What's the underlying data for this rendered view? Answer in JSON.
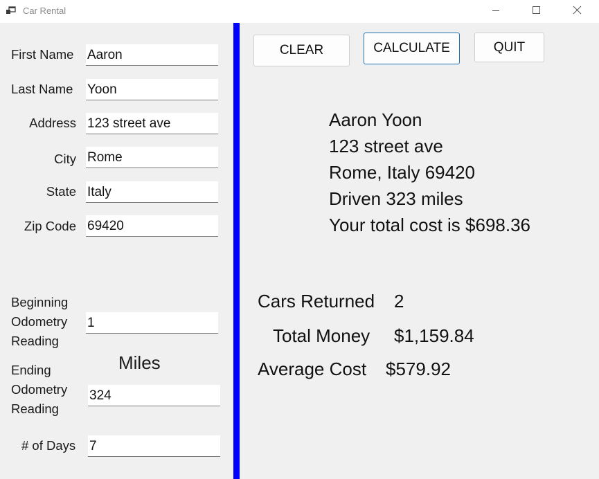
{
  "window": {
    "title": "Car Rental",
    "controls": {
      "minimize": "minimize-icon",
      "maximize": "maximize-icon",
      "close": "close-icon"
    }
  },
  "form": {
    "first_name_label": "First Name",
    "first_name": "Aaron",
    "last_name_label": "Last Name",
    "last_name": "Yoon",
    "address_label": "Address",
    "address": "123 street ave",
    "city_label": "City",
    "city": "Rome",
    "state_label": "State",
    "state": "Italy",
    "zip_label": "Zip Code",
    "zip": "69420",
    "begin_odo_label_1": "Beginning",
    "begin_odo_label_2": "Odometry",
    "begin_odo_label_3": "Reading",
    "begin_odo": "1",
    "miles_label": "Miles",
    "end_odo_label_1": "Ending",
    "end_odo_label_2": "Odometry",
    "end_odo_label_3": "Reading",
    "end_odo": "324",
    "days_label": "# of Days",
    "days": "7"
  },
  "buttons": {
    "clear": "CLEAR",
    "calculate": "CALCULATE",
    "quit": "QUIT"
  },
  "output": {
    "name_line": "Aaron Yoon",
    "address_line": "123 street ave",
    "city_line": "Rome, Italy 69420",
    "miles_line": "Driven 323 miles",
    "cost_line": "Your total cost is $698.36"
  },
  "stats": {
    "cars_returned_label": "Cars Returned",
    "cars_returned": "2",
    "total_money_label": "Total Money",
    "total_money": "$1,159.84",
    "average_cost_label": "Average Cost",
    "average_cost": "$579.92"
  },
  "colors": {
    "divider": "#0000ff",
    "focus_border": "#1f6fb3",
    "background": "#f0f0f0"
  }
}
